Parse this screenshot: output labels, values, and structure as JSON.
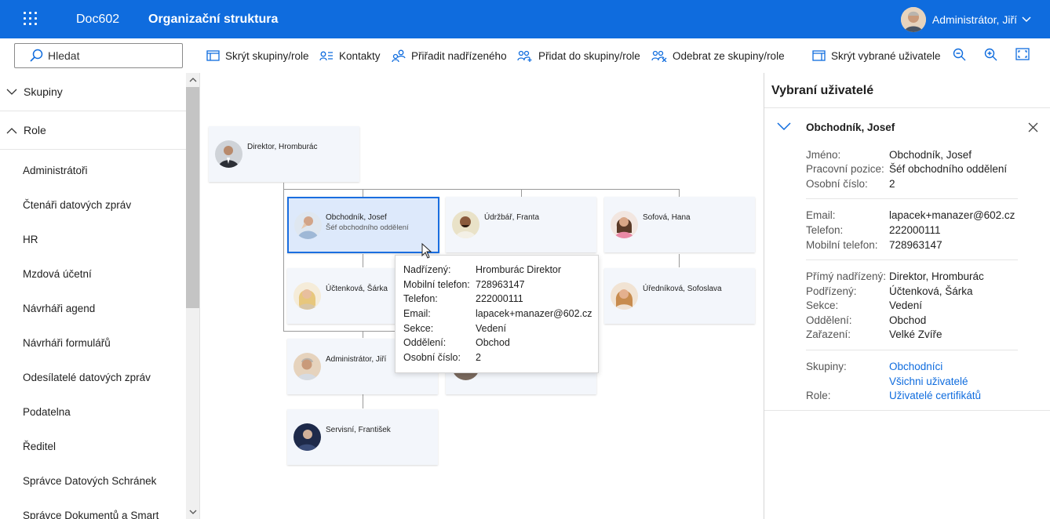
{
  "header": {
    "app_name": "Doc602",
    "page_title": "Organizační struktura",
    "user_name": "Administrátor, Jiří"
  },
  "toolbar": {
    "search_placeholder": "Hledat",
    "hide_groups": "Skrýt skupiny/role",
    "contacts": "Kontakty",
    "assign_superior": "Přiřadit nadřízeného",
    "add_to_group": "Přidat do skupiny/role",
    "remove_from_group": "Odebrat ze skupiny/role",
    "hide_selected": "Skrýt vybrané uživatele"
  },
  "sidebar": {
    "sections": [
      {
        "label": "Skupiny",
        "expanded": false
      },
      {
        "label": "Role",
        "expanded": true
      }
    ],
    "items": [
      "Administrátoři",
      "Čtenáři datových zpráv",
      "HR",
      "Mzdová účetní",
      "Návrháři agend",
      "Návrháři formulářů",
      "Odesílatelé datových zpráv",
      "Podatelna",
      "Ředitel",
      "Správce Datových Schránek",
      "Správce Dokumentů a Smart"
    ]
  },
  "org": {
    "cards": [
      {
        "name": "Direktor, Hromburác",
        "subtitle": ""
      },
      {
        "name": "Obchodník, Josef",
        "subtitle": "Šéf obchodního oddělení"
      },
      {
        "name": "Údržbář, Franta",
        "subtitle": ""
      },
      {
        "name": "Sofová, Hana",
        "subtitle": ""
      },
      {
        "name": "Účtenková, Šárka",
        "subtitle": ""
      },
      {
        "name": "Úředníková, Sofoslava",
        "subtitle": ""
      },
      {
        "name": "Administrátor, Jiří",
        "subtitle": ""
      },
      {
        "name": "Servisní, František",
        "subtitle": ""
      }
    ]
  },
  "tooltip": {
    "rows": [
      {
        "k": "Nadřízený:",
        "v": "Hromburác Direktor"
      },
      {
        "k": "Mobilní telefon:",
        "v": "728963147"
      },
      {
        "k": "Telefon:",
        "v": "222000111"
      },
      {
        "k": "Email:",
        "v": "lapacek+manazer@602.cz"
      },
      {
        "k": "Sekce:",
        "v": "Vedení"
      },
      {
        "k": "Oddělení:",
        "v": "Obchod"
      },
      {
        "k": "Osobní číslo:",
        "v": "2"
      }
    ]
  },
  "panel": {
    "title": "Vybraní uživatelé",
    "selected_name": "Obchodník, Josef",
    "block1": [
      {
        "k": "Jméno:",
        "v": "Obchodník, Josef"
      },
      {
        "k": "Pracovní pozice:",
        "v": "Šéf obchodního oddělení"
      },
      {
        "k": "Osobní číslo:",
        "v": "2"
      }
    ],
    "block2": [
      {
        "k": "Email:",
        "v": "lapacek+manazer@602.cz"
      },
      {
        "k": "Telefon:",
        "v": "222000111"
      },
      {
        "k": "Mobilní telefon:",
        "v": "728963147"
      }
    ],
    "block3": [
      {
        "k": "Přímý nadřízený:",
        "v": "Direktor, Hromburác"
      },
      {
        "k": "Podřízený:",
        "v": "Účtenková, Šárka"
      },
      {
        "k": "Sekce:",
        "v": "Vedení"
      },
      {
        "k": "Oddělení:",
        "v": "Obchod"
      },
      {
        "k": "Zařazení:",
        "v": "Velké Zvíře"
      }
    ],
    "groups_label": "Skupiny:",
    "groups": [
      "Obchodníci",
      "Všichni uživatelé"
    ],
    "roles_label": "Role:",
    "roles": [
      "Uživatelé certifikátů"
    ]
  },
  "colors": {
    "accent": "#0f6cde",
    "card_bg": "#f3f6fb",
    "card_selected": "#dde9fb"
  }
}
